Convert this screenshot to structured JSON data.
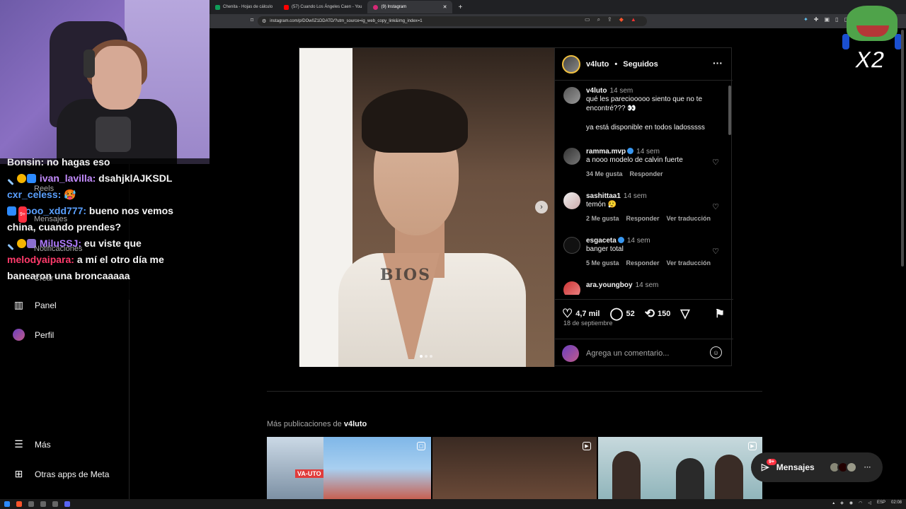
{
  "browser": {
    "tabs": [
      {
        "label": "Chenita - Hojas de cálculo"
      },
      {
        "label": "(57) Cuando Los Ángeles Caen - You"
      },
      {
        "label": "(9) Instagram"
      }
    ],
    "new_tab_label": "+",
    "url": "instagram.com/p/DOw0Z1DDATD/?utm_source=ig_web_copy_link&img_index=1"
  },
  "chat": {
    "messages": [
      {
        "user": "Bonsin:",
        "text": "no hagas eso"
      },
      {
        "user": "ivan_lavilla:",
        "text": "dsahjklAJKSDL"
      },
      {
        "user": "cxr_celess:",
        "text": "🥵"
      },
      {
        "user": "liooo_xdd777:",
        "text": "bueno nos vemos"
      },
      {
        "user": "",
        "text": "china, cuando prendes?"
      },
      {
        "user": "MiluSSJ:",
        "text": "eu viste que"
      },
      {
        "user": "melodyaipara:",
        "text": "a mí el otro día me"
      },
      {
        "user": "",
        "text": "banearon una broncaaaaa"
      }
    ],
    "ghost_labels": [
      "Reels",
      "Mensajes",
      "Notificaciones",
      "Crear"
    ],
    "ghost_badge": "9+"
  },
  "sidebar": {
    "items": [
      {
        "label": "Panel",
        "icon": "chart-icon"
      },
      {
        "label": "Perfil",
        "icon": "avatar"
      },
      {
        "label": "Más",
        "icon": "menu-icon"
      },
      {
        "label": "Otras apps de Meta",
        "icon": "meta-apps-icon"
      }
    ]
  },
  "post": {
    "author": "v4luto",
    "follow_state": "Seguidos",
    "caption": {
      "user": "v4luto",
      "time": "14 sem",
      "line1": "qué les pareciooooo siento que no te",
      "line2": "encontré??? 👀",
      "line3": "ya está disponible en todos ladosssss"
    },
    "comments": [
      {
        "user": "ramma.mvp",
        "time": "14 sem",
        "text": "a nooo modelo de calvin fuerte",
        "likes": "34 Me gusta",
        "reply": "Responder",
        "translate": ""
      },
      {
        "user": "sashittaa1",
        "time": "14 sem",
        "text": "temón 😮‍💨",
        "likes": "2 Me gusta",
        "reply": "Responder",
        "translate": "Ver traducción"
      },
      {
        "user": "esgaceta",
        "time": "14 sem",
        "text": "banger total",
        "likes": "5 Me gusta",
        "reply": "Responder",
        "translate": "Ver traducción"
      },
      {
        "user": "ara.youngboy",
        "time": "14 sem",
        "text": "",
        "likes": "",
        "reply": "",
        "translate": ""
      }
    ],
    "like_count": "4,7 mil",
    "comment_count": "52",
    "repost_count": "150",
    "date": "18 de septiembre",
    "add_comment_placeholder": "Agrega un comentario...",
    "photo_tattoo": "BIOS"
  },
  "more_posts": {
    "prefix": "Más publicaciones de",
    "author": "v4luto",
    "thumb1_text": "VA-UTO"
  },
  "messages_pill": {
    "label": "Mensajes",
    "badge": "9+",
    "more": "···"
  },
  "overlay": {
    "multiplier": "X2"
  },
  "taskbar": {
    "language": "ESP",
    "time": "02:08"
  },
  "colors": {
    "background": "#000000",
    "border": "#262626",
    "verified": "#3897f0",
    "notification": "#ff3040"
  }
}
